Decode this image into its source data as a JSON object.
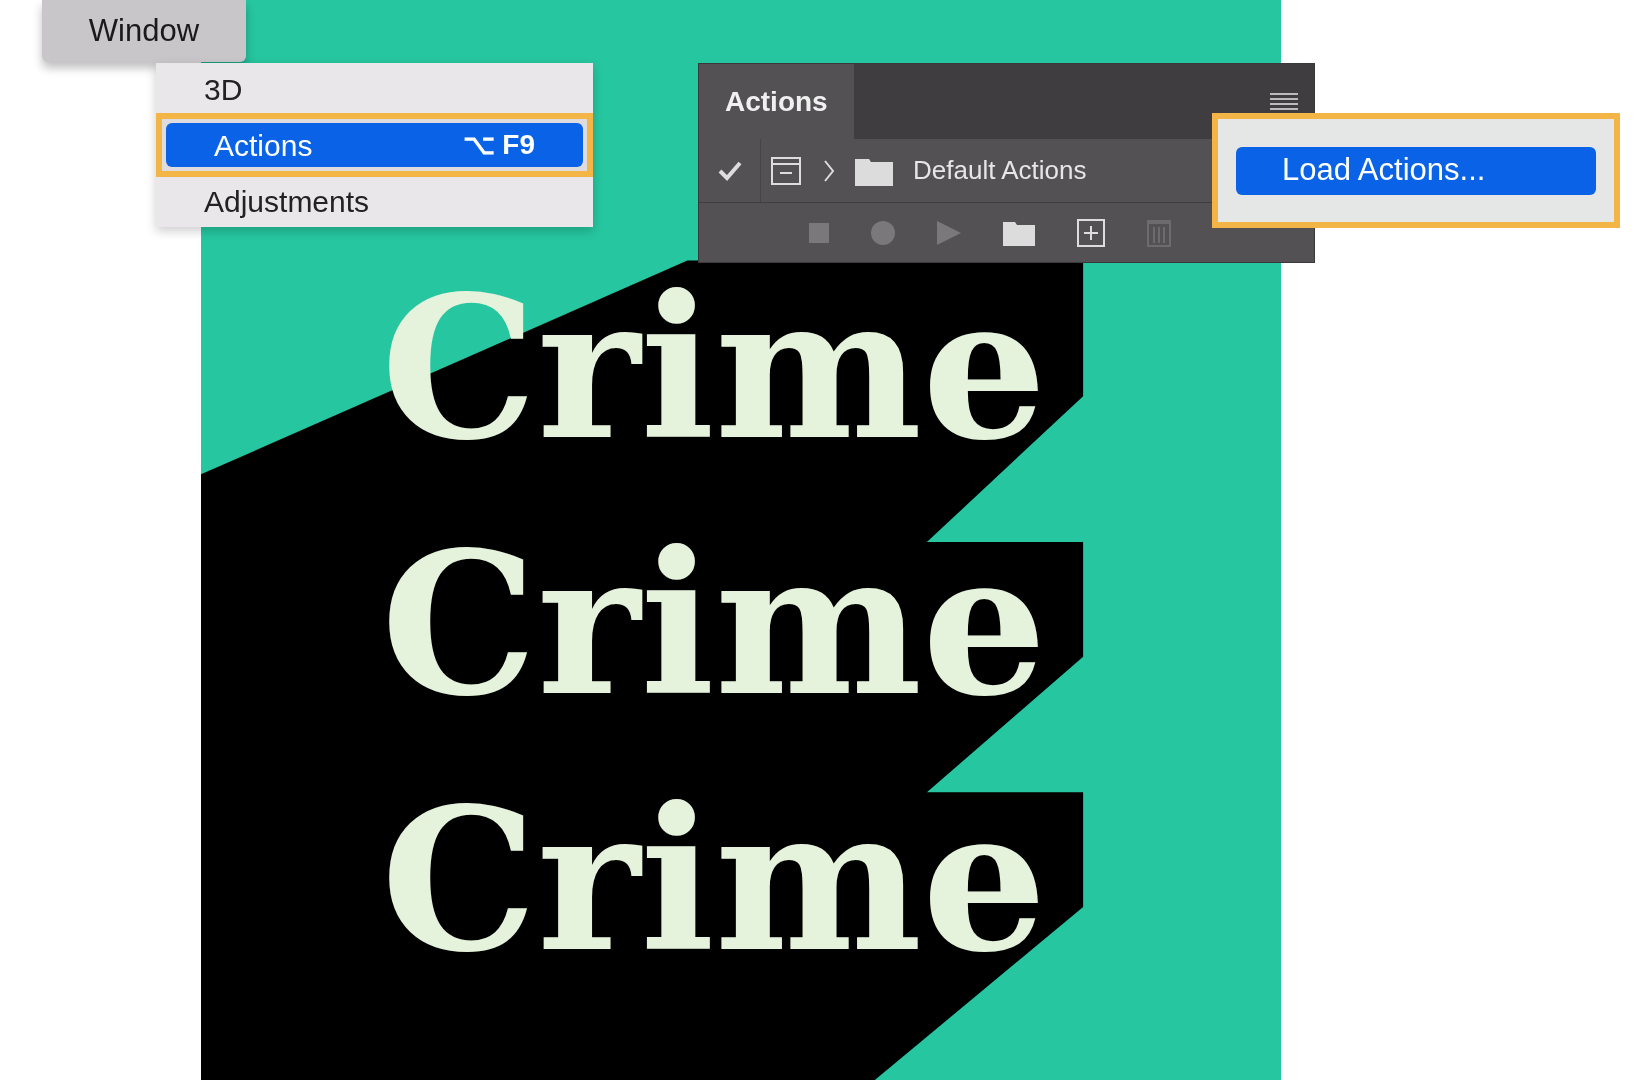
{
  "menu_bar": {
    "menu": "Window"
  },
  "window_menu": {
    "items": [
      {
        "label": "3D",
        "selected": false
      },
      {
        "label": "Actions",
        "shortcut": "⌥ F9",
        "selected": true
      },
      {
        "label": "Adjustments",
        "selected": false
      }
    ]
  },
  "actions_panel": {
    "tab": "Actions",
    "rows": [
      {
        "name": "Default Actions",
        "checked": true,
        "expanded": false
      }
    ]
  },
  "panel_menu": {
    "items": [
      {
        "label": "Load Actions...",
        "selected": true
      }
    ]
  },
  "canvas": {
    "lines": [
      "Crime",
      "Crime",
      "Crime"
    ]
  }
}
